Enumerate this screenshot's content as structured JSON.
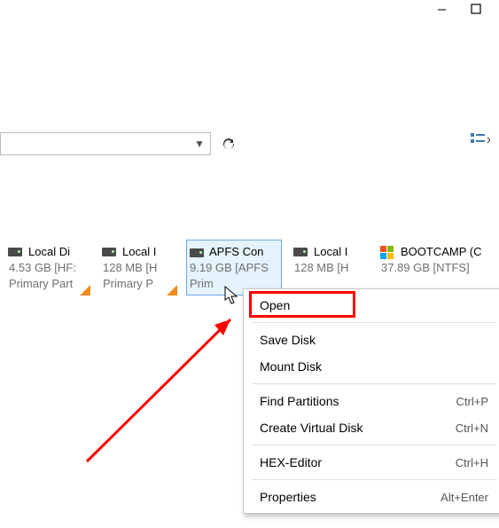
{
  "window": {
    "minimize": "—",
    "maximize": "□"
  },
  "toolbar": {
    "dropdown_value": "",
    "refresh": "⟳",
    "view": "▦"
  },
  "disks": [
    {
      "name": "Local Di",
      "size": "4.53 GB [HF:",
      "part": "Primary Part",
      "corner": true,
      "type": "hdd"
    },
    {
      "name": "Local I",
      "size": "128 MB [H",
      "part": "Primary P",
      "corner": true,
      "type": "hdd"
    },
    {
      "name": "APFS Con",
      "size": "9.19 GB [APFS",
      "part": "Prim",
      "corner": false,
      "type": "hdd",
      "selected": true
    },
    {
      "name": "Local I",
      "size": "128 MB [H",
      "part": "",
      "corner": false,
      "type": "hdd"
    },
    {
      "name": "BOOTCAMP (C",
      "size": "37.89 GB [NTFS]",
      "part": "",
      "corner": false,
      "type": "boot"
    }
  ],
  "context_menu": {
    "open": "Open",
    "save_disk": "Save Disk",
    "mount_disk": "Mount Disk",
    "find_partitions": {
      "label": "Find Partitions",
      "shortcut": "Ctrl+P"
    },
    "create_virtual_disk": {
      "label": "Create Virtual Disk",
      "shortcut": "Ctrl+N"
    },
    "hex_editor": {
      "label": "HEX-Editor",
      "shortcut": "Ctrl+H"
    },
    "properties": {
      "label": "Properties",
      "shortcut": "Alt+Enter"
    }
  }
}
